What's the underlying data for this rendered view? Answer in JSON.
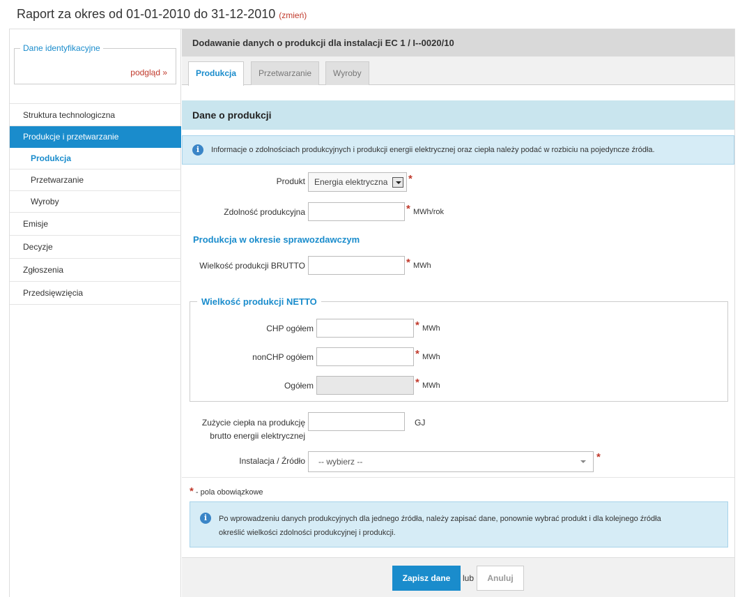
{
  "header": {
    "title": "Raport za okres od 01-01-2010 do 31-12-2010",
    "change_link": "zmień"
  },
  "sidebar": {
    "id_box": {
      "legend": "Dane identyfikacyjne",
      "preview": "podgląd »"
    },
    "items": [
      {
        "label": "Struktura technologiczna"
      },
      {
        "label": "Produkcje i przetwarzanie"
      },
      {
        "label": "Produkcja"
      },
      {
        "label": "Przetwarzanie"
      },
      {
        "label": "Wyroby"
      },
      {
        "label": "Emisje"
      },
      {
        "label": "Decyzje"
      },
      {
        "label": "Zgłoszenia"
      },
      {
        "label": "Przedsięwzięcia"
      }
    ]
  },
  "main": {
    "title": "Dodawanie danych o produkcji dla instalacji EC 1 / I--0020/10",
    "tabs": [
      {
        "label": "Produkcja"
      },
      {
        "label": "Przetwarzanie"
      },
      {
        "label": "Wyroby"
      }
    ],
    "section_title": "Dane o produkcji",
    "info_top": "Informacje o zdolnościach produkcyjnych i produkcji energii elektrycznej oraz ciepła należy podać w rozbiciu na pojedyncze źródła.",
    "form": {
      "product_label": "Produkt",
      "product_value": "Energia elektryczna",
      "capacity_label": "Zdolność produkcyjna",
      "capacity_unit": "MWh/rok",
      "period_heading": "Produkcja w okresie sprawozdawczym",
      "brutto_label": "Wielkość produkcji BRUTTO",
      "brutto_unit": "MWh",
      "netto_legend": "Wielkość produkcji NETTO",
      "chp_label": "CHP ogółem",
      "chp_unit": "MWh",
      "nonchp_label": "nonCHP ogółem",
      "nonchp_unit": "MWh",
      "total_label": "Ogółem",
      "total_unit": "MWh",
      "heat_label_1": "Zużycie ciepła na produkcję",
      "heat_label_2": "brutto energii elektrycznej",
      "heat_unit": "GJ",
      "source_label": "Instalacja / Źródło",
      "source_value": "-- wybierz --",
      "required_star": "*",
      "required_note": " - pola obowiązkowe"
    },
    "info_bottom_1": "Po wprowadzeniu danych produkcyjnych dla jednego źródła, należy zapisać dane, ponownie wybrać produkt i dla kolejnego źródła",
    "info_bottom_2": "określić wielkości zdolności produkcyjnej i produkcji.",
    "buttons": {
      "save": "Zapisz dane",
      "or": "lub",
      "cancel": "Anuluj"
    }
  }
}
